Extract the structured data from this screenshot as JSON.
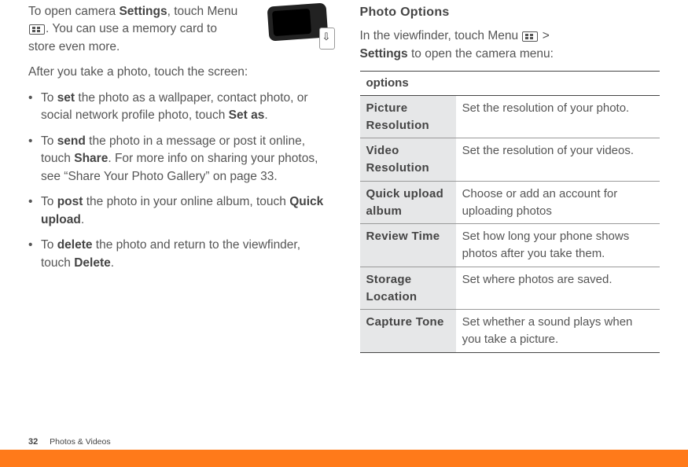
{
  "left": {
    "intro": {
      "t1": "To open camera ",
      "b1": "Settings",
      "t2": ", touch Menu ",
      "t3": ". You can use a memory card to store even more."
    },
    "after_photo": "After you take a photo, touch the screen:",
    "bullets": [
      {
        "t1": "To ",
        "b1": "set",
        "t2": " the photo as a wallpaper, contact photo, or social network profile photo, touch ",
        "b2": "Set as",
        "t3": "."
      },
      {
        "t1": "To ",
        "b1": "send",
        "t2": " the photo in a message or post it online, touch ",
        "b2": "Share",
        "t3": ". For more info on sharing your photos, see “Share Your Photo Gallery” on page 33."
      },
      {
        "t1": "To ",
        "b1": "post",
        "t2": " the photo in your online album, touch ",
        "b2": "Quick upload",
        "t3": "."
      },
      {
        "t1": "To ",
        "b1": "delete",
        "t2": " the photo and return to the viewfinder, touch ",
        "b2": "Delete",
        "t3": "."
      }
    ]
  },
  "right": {
    "title": "Photo Options",
    "intro": {
      "t1": "In the viewfinder, touch Menu ",
      "t2": " > ",
      "b1": "Settings",
      "t3": " to open the camera menu:"
    },
    "table_header": "options",
    "rows": [
      {
        "name": "Picture Resolution",
        "desc": "Set the resolution of your photo."
      },
      {
        "name": "Video Resolution",
        "desc": "Set the resolution of your videos."
      },
      {
        "name": "Quick upload album",
        "desc": "Choose or add an account for uploading photos"
      },
      {
        "name": "Review Time",
        "desc": "Set how long your phone shows photos after you take them."
      },
      {
        "name": "Storage Location",
        "desc": "Set where photos are saved."
      },
      {
        "name": "Capture Tone",
        "desc": "Set whether a sound plays when you take a picture."
      }
    ]
  },
  "footer": {
    "page_num": "32",
    "section": "Photos & Videos"
  }
}
